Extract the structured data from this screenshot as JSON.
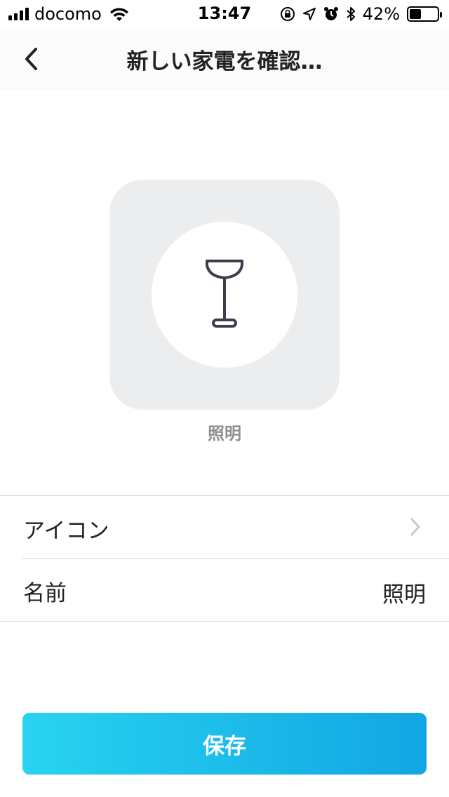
{
  "status_bar": {
    "carrier": "docomo",
    "time": "13:47",
    "battery_percent": "42%",
    "battery_level": 0.42
  },
  "nav": {
    "title": "新しい家電を確認…"
  },
  "device": {
    "icon": "floor-lamp-icon",
    "caption": "照明"
  },
  "settings": {
    "icon_row_label": "アイコン",
    "name_row_label": "名前",
    "name_row_value": "照明"
  },
  "actions": {
    "save_label": "保存"
  },
  "colors": {
    "accent_start": "#28d3f0",
    "accent_end": "#12a6e4"
  }
}
